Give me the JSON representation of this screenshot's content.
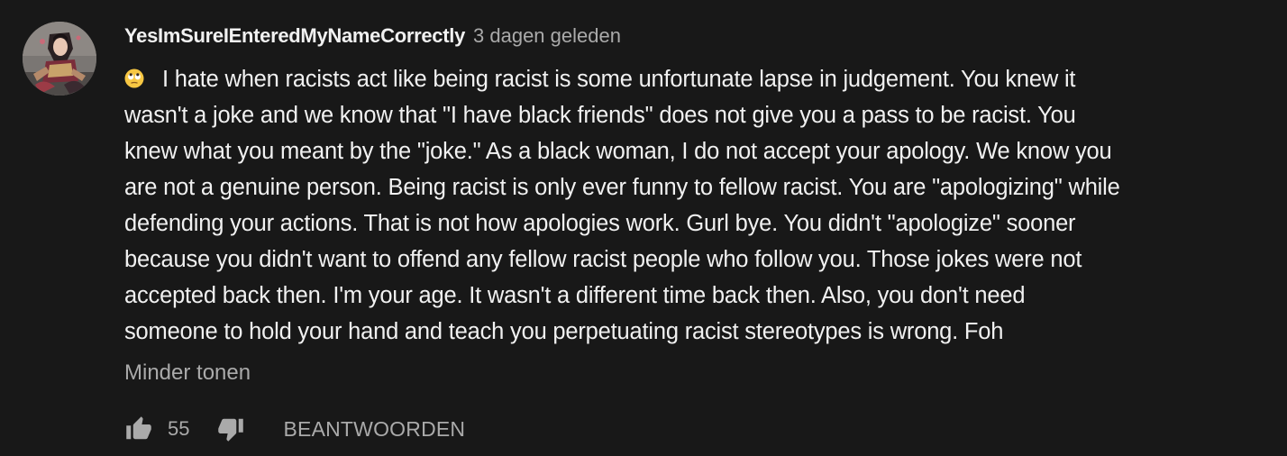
{
  "comment": {
    "author": "YesImSureIEnteredMyNameCorrectly",
    "timestamp": "3 dagen geleden",
    "emoji_icon": "face-with-rolling-eyes-emoji",
    "text_lines": [
      "I hate when racists act like being racist is some unfortunate lapse in judgement. You knew it",
      "wasn't a joke and we know that \"I have black friends\" does not give you a pass to be racist. You",
      "knew what you meant by the \"joke.\" As a black woman, I do not accept your apology. We know you",
      "are not a genuine person. Being racist is only ever funny to fellow racist. You are \"apologizing\" while",
      "defending your actions. That is not how apologies work. Gurl bye. You didn't \"apologize\" sooner",
      "because you didn't want to offend any fellow racist people who follow you. Those jokes were not",
      "accepted back then. I'm your age. It wasn't a different time back then. Also, you don't need",
      "someone to hold your hand and teach you perpetuating racist stereotypes is wrong. Foh"
    ],
    "show_less_label": "Minder tonen",
    "like_icon": "thumbs-up-icon",
    "like_count": "55",
    "dislike_icon": "thumbs-down-icon",
    "reply_label": "BEANTWOORDEN"
  },
  "colors": {
    "background": "#181818",
    "primary_text": "#f1f1f1",
    "secondary_text": "#aaaaaa"
  }
}
